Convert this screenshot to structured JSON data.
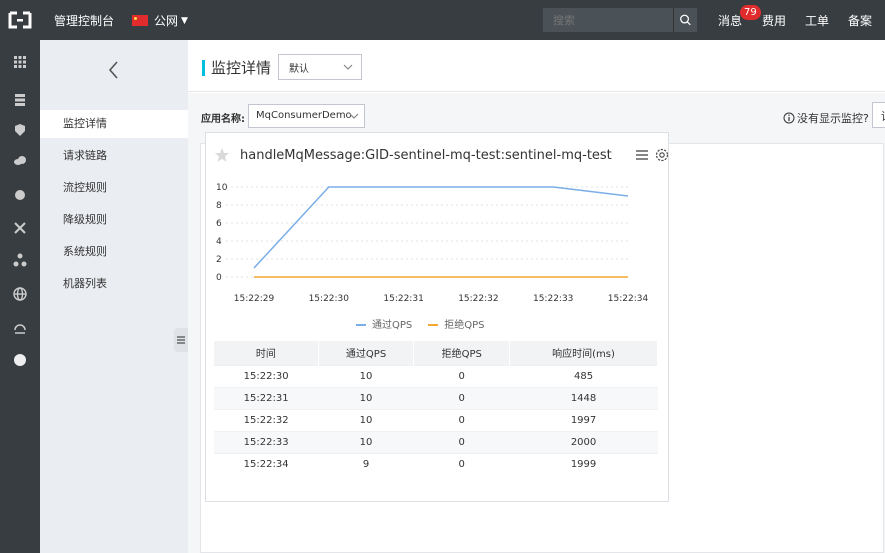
{
  "topbar": {
    "console_title": "管理控制台",
    "region": "公网",
    "search_placeholder": "搜索",
    "messages_label": "消息",
    "messages_count": "79",
    "fees_label": "费用",
    "tickets_label": "工单",
    "filing_label": "备案"
  },
  "sidebar": {
    "items": [
      {
        "label": "监控详情",
        "active": true
      },
      {
        "label": "请求链路"
      },
      {
        "label": "流控规则"
      },
      {
        "label": "降级规则"
      },
      {
        "label": "系统规则"
      },
      {
        "label": "机器列表"
      }
    ]
  },
  "header": {
    "title": "监控详情",
    "mode_select": "默认"
  },
  "toolbar": {
    "app_label": "应用名称:",
    "app_value": "MqConsumerDemo",
    "tip": "没有显示监控?",
    "cut_button": "请"
  },
  "card": {
    "title": "handleMqMessage:GID-sentinel-mq-test:sentinel-mq-test",
    "table": {
      "headers": [
        "时间",
        "通过QPS",
        "拒绝QPS",
        "响应时间(ms)"
      ],
      "rows": [
        [
          "15:22:30",
          "10",
          "0",
          "485"
        ],
        [
          "15:22:31",
          "10",
          "0",
          "1448"
        ],
        [
          "15:22:32",
          "10",
          "0",
          "1997"
        ],
        [
          "15:22:33",
          "10",
          "0",
          "2000"
        ],
        [
          "15:22:34",
          "9",
          "0",
          "1999"
        ]
      ]
    }
  },
  "colors": {
    "pass": "#7aaee8",
    "block": "#f0a830",
    "accent": "#00c1de"
  },
  "chart_data": {
    "type": "line",
    "x": [
      "15:22:29",
      "15:22:30",
      "15:22:31",
      "15:22:32",
      "15:22:33",
      "15:22:34"
    ],
    "y_ticks": [
      "0",
      "2",
      "4",
      "6",
      "8",
      "10"
    ],
    "ylim": [
      0,
      10
    ],
    "series": [
      {
        "name": "通过QPS",
        "values": [
          1,
          10,
          10,
          10,
          10,
          9
        ]
      },
      {
        "name": "拒绝QPS",
        "values": [
          0,
          0,
          0,
          0,
          0,
          0
        ]
      }
    ],
    "legend_position": "bottom"
  }
}
